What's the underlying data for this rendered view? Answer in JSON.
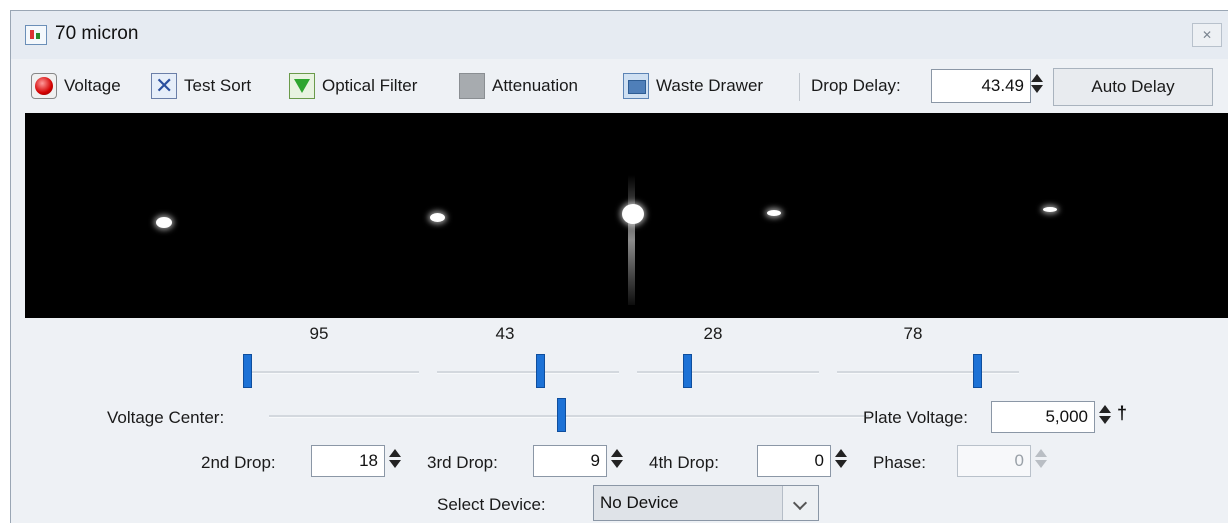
{
  "window": {
    "title": "70 micron",
    "close_glyph": "✕"
  },
  "toolbar": {
    "voltage_label": "Voltage",
    "test_sort_label": "Test Sort",
    "optical_filter_label": "Optical Filter",
    "attenuation_label": "Attenuation",
    "waste_drawer_label": "Waste Drawer",
    "drop_delay_label": "Drop Delay:",
    "drop_delay_value": "43.49",
    "auto_delay_label": "Auto Delay"
  },
  "sliders": {
    "values": [
      "95",
      "43",
      "28",
      "78"
    ]
  },
  "voltage_center": {
    "label": "Voltage Center:"
  },
  "plate_voltage": {
    "label": "Plate Voltage:",
    "value": "5,000"
  },
  "drops": {
    "second_label": "2nd Drop:",
    "second_value": "18",
    "third_label": "3rd Drop:",
    "third_value": "9",
    "fourth_label": "4th Drop:",
    "fourth_value": "0",
    "phase_label": "Phase:",
    "phase_value": "0"
  },
  "device": {
    "label": "Select Device:",
    "selected": "No Device"
  },
  "icons": {
    "voltage": "voltage-icon",
    "test_sort": "test-sort-icon",
    "optical_filter": "optical-filter-icon",
    "attenuation": "attenuation-icon",
    "waste_drawer": "waste-drawer-icon"
  }
}
